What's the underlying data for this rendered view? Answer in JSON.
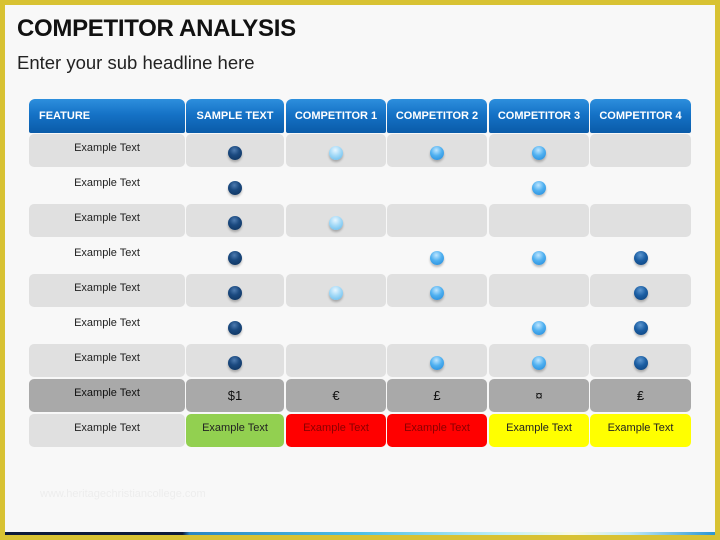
{
  "title": "COMPETITOR ANALYSIS",
  "subtitle": "Enter your sub headline here",
  "watermark": "www.heritagechristiancollege.com",
  "colors": {
    "header_blue": "#1572c6",
    "row_grey": "#e0e0e0",
    "price_grey": "#a9a9a9",
    "green": "#92d050",
    "red": "#ff0000",
    "yellow": "#ffff00",
    "frame_gold": "#d8c233"
  },
  "table": {
    "headers": [
      "FEATURE",
      "SAMPLE TEXT",
      "COMPETITOR 1",
      "COMPETITOR 2",
      "COMPETITOR 3",
      "COMPETITOR 4"
    ],
    "marker_legend": {
      "navy": "dark-navy-ball",
      "light": "light-blue-ball",
      "mid": "medium-blue-ball",
      "dark": "dark-blue-ball"
    },
    "rows": [
      {
        "feature": "Example Text",
        "markers": [
          "navy",
          "light",
          "mid",
          "mid",
          ""
        ]
      },
      {
        "feature": "Example Text",
        "markers": [
          "navy",
          "",
          "",
          "mid",
          ""
        ]
      },
      {
        "feature": "Example Text",
        "markers": [
          "navy",
          "light",
          "",
          "",
          ""
        ]
      },
      {
        "feature": "Example Text",
        "markers": [
          "navy",
          "",
          "mid",
          "mid",
          "dark"
        ]
      },
      {
        "feature": "Example Text",
        "markers": [
          "navy",
          "light",
          "mid",
          "",
          "dark"
        ]
      },
      {
        "feature": "Example Text",
        "markers": [
          "navy",
          "",
          "",
          "mid",
          "dark"
        ]
      },
      {
        "feature": "Example Text",
        "markers": [
          "navy",
          "",
          "mid",
          "mid",
          "dark"
        ]
      }
    ],
    "price_row": {
      "feature": "Example Text",
      "values": [
        "$1",
        "€",
        "£",
        "¤",
        "₤"
      ]
    },
    "rating_row": {
      "feature": "Example Text",
      "values": [
        {
          "label": "Example Text",
          "color": "#92d050",
          "text_color": "#222222"
        },
        {
          "label": "Example Text",
          "color": "#ff0000",
          "text_color": "#8a0000"
        },
        {
          "label": "Example Text",
          "color": "#ff0000",
          "text_color": "#8a0000"
        },
        {
          "label": "Example Text",
          "color": "#ffff00",
          "text_color": "#222222"
        },
        {
          "label": "Example Text",
          "color": "#ffff00",
          "text_color": "#222222"
        }
      ]
    }
  }
}
